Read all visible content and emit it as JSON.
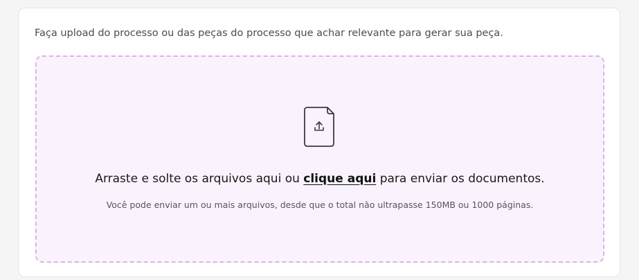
{
  "upload": {
    "intro_text": "Faça upload do processo ou das peças do processo que achar relevante para gerar sua peça.",
    "dropzone": {
      "icon": "file-upload-icon",
      "text_before": "Arraste e solte os arquivos aqui ou ",
      "link_text": "clique aqui",
      "text_after": " para enviar os documentos.",
      "hint": "Você pode enviar um ou mais arquivos, desde que o total não ultrapasse 150MB ou 1000 páginas."
    }
  },
  "colors": {
    "dropzone_border": "#dfb0ea",
    "dropzone_background": "#faf3fd",
    "card_border": "#e4e4e7"
  }
}
